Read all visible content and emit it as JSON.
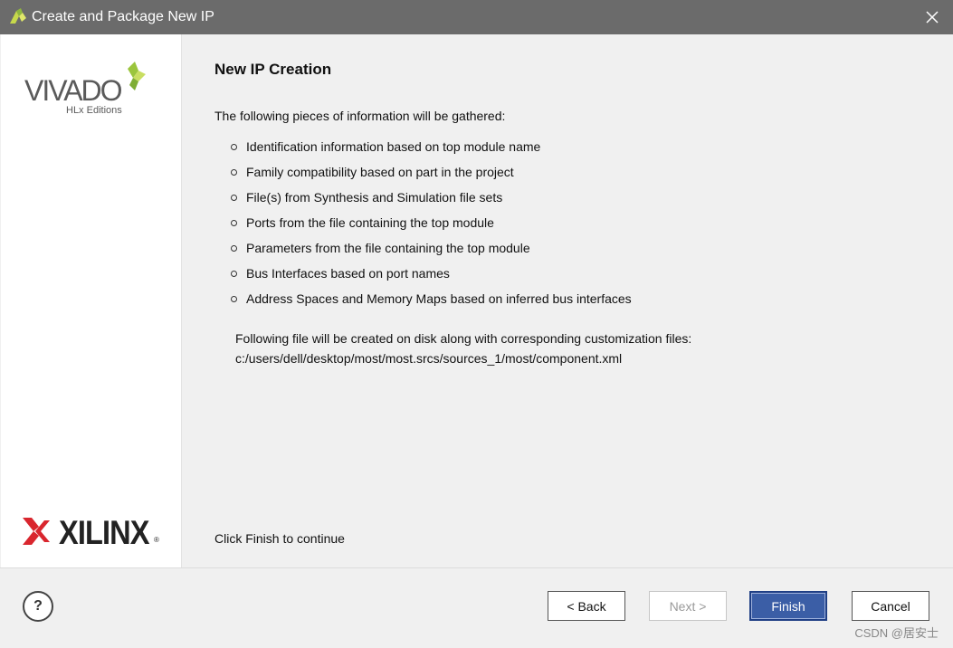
{
  "window": {
    "title": "Create and Package New IP"
  },
  "sidebar": {
    "vivado_logo_text": "VIVADO",
    "vivado_edition_text": "HLx Editions",
    "xilinx_logo_text": "XILINX",
    "xilinx_reg": "®"
  },
  "content": {
    "title": "New IP Creation",
    "intro": "The following pieces of information will be gathered:",
    "bullets": [
      "Identification information based on top module name",
      "Family compatibility based on part in the project",
      "File(s) from Synthesis and Simulation file sets",
      "Ports from the file containing the top module",
      "Parameters from the file containing the top module",
      "Bus Interfaces based on port names",
      "Address Spaces and Memory Maps based on inferred bus interfaces"
    ],
    "file_note_line1": "Following file will be created on disk along with corresponding customization files:",
    "file_note_line2": "c:/users/dell/desktop/most/most.srcs/sources_1/most/component.xml",
    "continue_text": "Click Finish to continue"
  },
  "footer": {
    "help_label": "?",
    "back_label": "< Back",
    "next_label": "Next >",
    "finish_label": "Finish",
    "cancel_label": "Cancel",
    "watermark": "CSDN @居安士"
  },
  "colors": {
    "titlebar": "#6b6b6b",
    "finish_button": "#3b5ea6",
    "vivado_green": "#9bc53d"
  }
}
